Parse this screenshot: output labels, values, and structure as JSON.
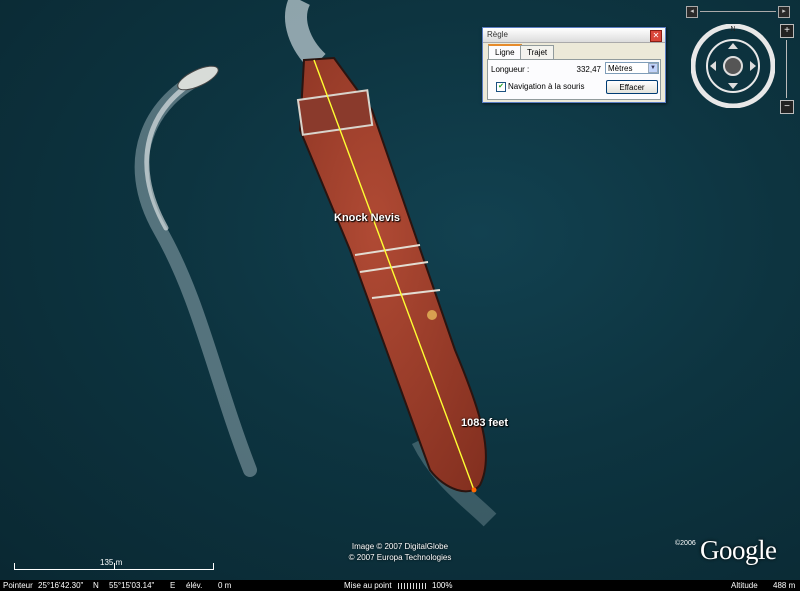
{
  "map": {
    "ship_name": "Knock Nevis",
    "measure_label": "1083 feet",
    "imagery_credit": "Image © 2007 DigitalGlobe",
    "data_credit": "© 2007 Europa Technologies",
    "copyright_year": "©2006",
    "logo_text": "Google",
    "scale_label": "135 m",
    "water_color": "#0d3440",
    "hull_color": "#9a3d2b",
    "measure_line_color": "#ffff33"
  },
  "status_bar": {
    "pointer_label": "Pointeur",
    "latitude": "25°16'42.30\"",
    "lat_hemisphere": "N",
    "longitude": "55°15'03.14\"",
    "lon_hemisphere": "E",
    "elevation_label": "élév.",
    "elevation_value": "0 m",
    "stream_label": "Mise au point",
    "stream_percent": "100%",
    "altitude_label": "Altitude",
    "altitude_value": "488 m"
  },
  "navigation": {
    "zoom_in_label": "+",
    "zoom_out_label": "−",
    "north_label": "N"
  },
  "ruler_dialog": {
    "title": "Règle",
    "close_label": "✕",
    "tabs": [
      "Ligne",
      "Trajet"
    ],
    "active_tab": "Ligne",
    "length_label": "Longueur :",
    "length_value": "332,47",
    "unit_value": "Mètres",
    "mouse_nav_label": "Navigation à la souris",
    "mouse_nav_checked": true,
    "clear_button_label": "Effacer"
  }
}
